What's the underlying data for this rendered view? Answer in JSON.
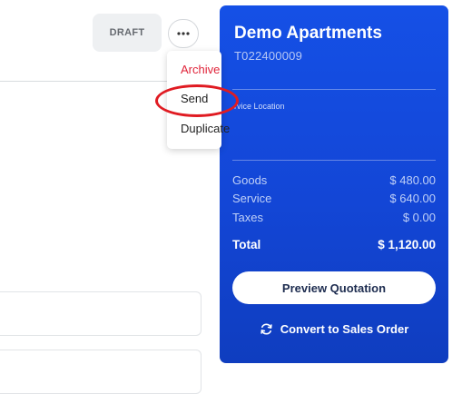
{
  "status_badge": "DRAFT",
  "more_menu": {
    "items": [
      {
        "label": "Archive",
        "color": "#e0243a"
      },
      {
        "label": "Send"
      },
      {
        "label": "Duplicate"
      }
    ]
  },
  "summary": {
    "customer_name": "Demo Apartments",
    "quote_number": "T022400009",
    "service_location_label": "rvice Location",
    "rows": [
      {
        "label": "Goods",
        "value": "$ 480.00"
      },
      {
        "label": "Service",
        "value": "$ 640.00"
      },
      {
        "label": "Taxes",
        "value": "$ 0.00"
      }
    ],
    "total": {
      "label": "Total",
      "value": "$ 1,120.00"
    },
    "preview_button": "Preview Quotation",
    "convert_link": "Convert to Sales Order"
  },
  "colors": {
    "card_blue": "#1550e6",
    "annotation_red": "#e01b22"
  }
}
